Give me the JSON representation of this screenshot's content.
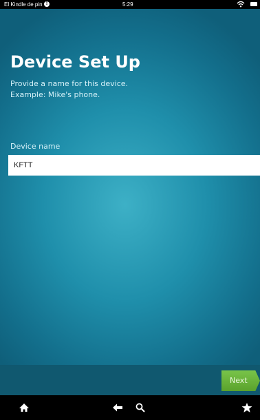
{
  "status_bar": {
    "carrier": "El Kindle de pin",
    "alert_glyph": "!",
    "time": "5:29",
    "icons": [
      "alert-icon",
      "wifi-icon",
      "battery-icon"
    ]
  },
  "main": {
    "title": "Device Set Up",
    "subtitle_line1": "Provide a name for this device.",
    "subtitle_line2": "Example: Mike's phone.",
    "field_label": "Device name",
    "field_value": "KFTT"
  },
  "action_bar": {
    "next_label": "Next",
    "next_color": "#6bb53c"
  },
  "nav_bar": {
    "icons": [
      "home-icon",
      "back-arrow-icon",
      "search-icon",
      "favorites-star-icon"
    ]
  },
  "colors": {
    "background_center": "#3db0c6",
    "background_edge": "#0f5f7a"
  }
}
